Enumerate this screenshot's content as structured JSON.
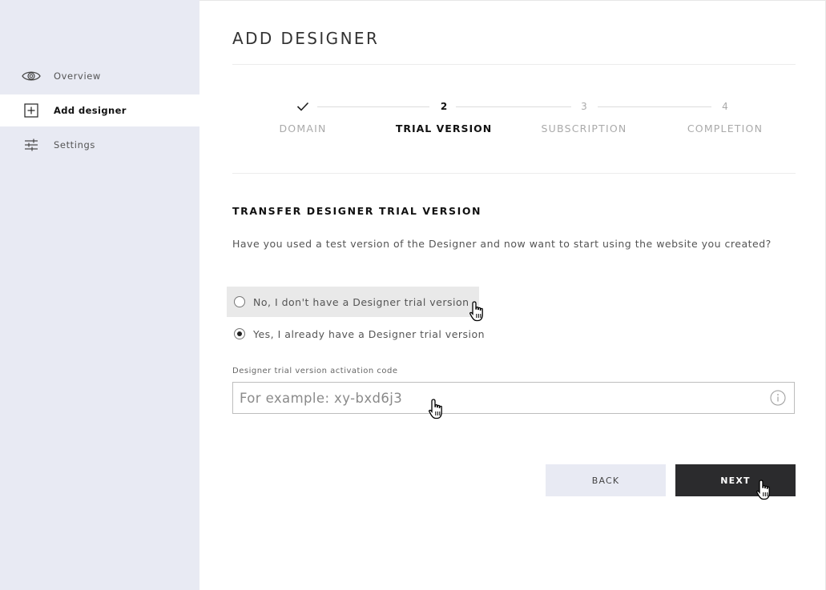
{
  "sidebar": {
    "items": [
      {
        "label": "Overview",
        "icon": "eye-icon"
      },
      {
        "label": "Add designer",
        "icon": "plus-square-icon",
        "active": true
      },
      {
        "label": "Settings",
        "icon": "sliders-icon"
      }
    ]
  },
  "main": {
    "title": "ADD DESIGNER",
    "steps": [
      {
        "marker": "✓",
        "label": "DOMAIN",
        "state": "done"
      },
      {
        "marker": "2",
        "label": "TRIAL VERSION",
        "state": "current"
      },
      {
        "marker": "3",
        "label": "SUBSCRIPTION",
        "state": "upcoming"
      },
      {
        "marker": "4",
        "label": "COMPLETION",
        "state": "upcoming"
      }
    ],
    "section_heading": "TRANSFER DESIGNER TRIAL VERSION",
    "question": "Have you used a test version of the Designer and now want to start using the website you created?",
    "options": [
      {
        "label": "No, I don't have a Designer trial version",
        "checked": false
      },
      {
        "label": "Yes, I already have a Designer trial version",
        "checked": true
      }
    ],
    "code_field": {
      "label": "Designer trial version activation code",
      "value": "",
      "placeholder": "For example: xy-bxd6j3"
    },
    "buttons": {
      "back": "BACK",
      "next": "NEXT"
    }
  },
  "colors": {
    "sidebar_bg": "#e8eaf3",
    "primary_button": "#2b2b2d",
    "secondary_button": "#e8eaf3"
  }
}
